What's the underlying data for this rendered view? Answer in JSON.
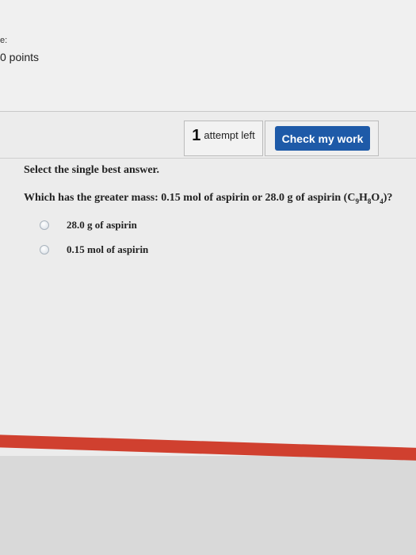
{
  "header": {
    "corner_text": "e:",
    "points_text": "0 points"
  },
  "toolbar": {
    "attempts_count": "1",
    "attempts_text": "attempt left",
    "check_label": "Check my work"
  },
  "question": {
    "instruction": "Select the single best answer.",
    "prompt_prefix": "Which has the greater mass: 0.15 mol of aspirin or 28.0 g of aspirin (C",
    "formula": {
      "c_sub": "9",
      "h": "H",
      "h_sub": "8",
      "o": "O",
      "o_sub": "4",
      "close": ")?"
    },
    "options": [
      {
        "label": "28.0 g of aspirin",
        "selected": false
      },
      {
        "label": "0.15 mol of aspirin",
        "selected": false
      }
    ]
  },
  "colors": {
    "accent": "#1e5aa8",
    "stripe": "#d0402f"
  }
}
